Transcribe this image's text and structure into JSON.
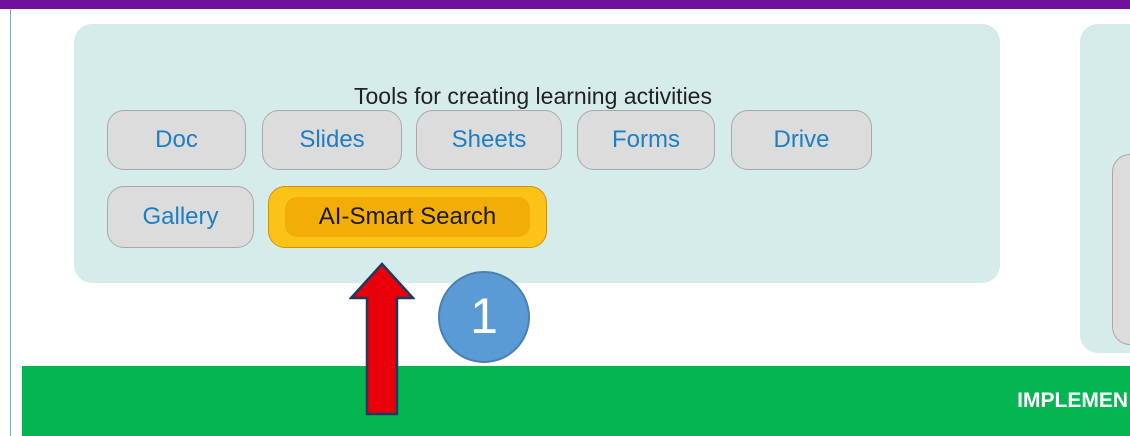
{
  "panel": {
    "title": "Tools for creating learning activities",
    "row1": [
      "Doc",
      "Slides",
      "Sheets",
      "Forms",
      "Drive"
    ],
    "row2": [
      "Gallery"
    ],
    "highlighted": "AI-Smart Search"
  },
  "annotation": {
    "step_number": "1",
    "arrow_color": "#e8000b",
    "circle_color": "#5b9bd5",
    "arrow_icon": "up-arrow"
  },
  "banner": {
    "text": "IMPLEMEN",
    "color": "#05b551"
  },
  "colors": {
    "top_bar": "#70119e",
    "panel_bg": "#d6ecea",
    "button_text": "#1c7fc5",
    "highlight_bg": "#fbc31a"
  }
}
